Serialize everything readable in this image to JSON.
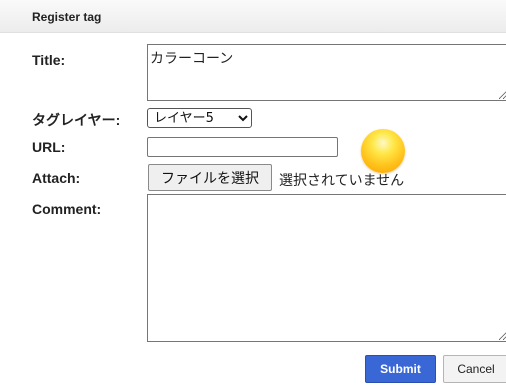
{
  "dialog": {
    "title": "Register tag"
  },
  "form": {
    "title_label": "Title:",
    "title_value": "カラーコーン",
    "layer_label": "タグレイヤー:",
    "layer_selected": "レイヤー5",
    "url_label": "URL:",
    "url_value": "",
    "attach_label": "Attach:",
    "file_button_label": "ファイルを選択",
    "file_status": "選択されていません",
    "comment_label": "Comment:",
    "comment_value": ""
  },
  "buttons": {
    "submit": "Submit",
    "cancel": "Cancel"
  },
  "colors": {
    "submit_bg": "#3a67d6",
    "ball": "#ffc21a"
  }
}
